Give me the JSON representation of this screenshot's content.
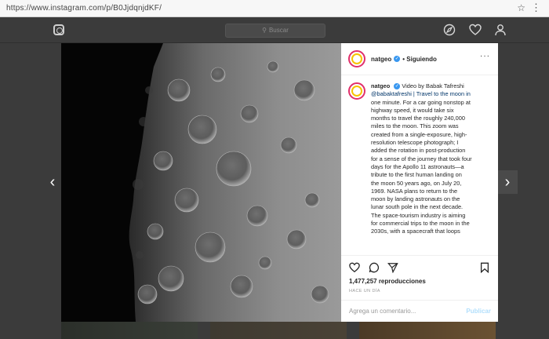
{
  "browser": {
    "url": "https://www.instagram.com/p/B0JjdqnjdKF/",
    "star_icon": "star-icon",
    "menu_icon": "kebab-menu-icon"
  },
  "header": {
    "search_placeholder": "Buscar"
  },
  "post": {
    "username": "natgeo",
    "follow_state": "Siguiendo",
    "caption_user": "natgeo",
    "caption_lines": [
      "Video by Babak Tafreshi",
      "@babaktafreshi | Travel to the moon in",
      "one minute. For a car going nonstop at",
      "highway speed, it would take six",
      "months to travel the roughly 240,000",
      "miles to the moon. This zoom was",
      "created from a single-exposure, high-",
      "resolution telescope photograph; I",
      "added the rotation in post-production",
      "for a sense of the journey that took four",
      "days for the Apollo 11 astronauts—a",
      "tribute to the first human landing on",
      "the moon 50 years ago, on July 20,",
      "1969. NASA plans to return to the",
      "moon by landing astronauts on the",
      "lunar south pole in the next decade.",
      "The space-tourism industry is aiming",
      "for commercial trips to the moon in the",
      "2030s, with a spacecraft that loops"
    ],
    "views": "1,477,257 reproducciones",
    "timestamp": "HACE UN DÍA",
    "comment_placeholder": "Agrega un comentario...",
    "publish_label": "Publicar"
  },
  "colors": {
    "verified": "#3897f0",
    "publish_disabled": "#b2dffc",
    "overlay_bg": "#3b3b3b"
  }
}
